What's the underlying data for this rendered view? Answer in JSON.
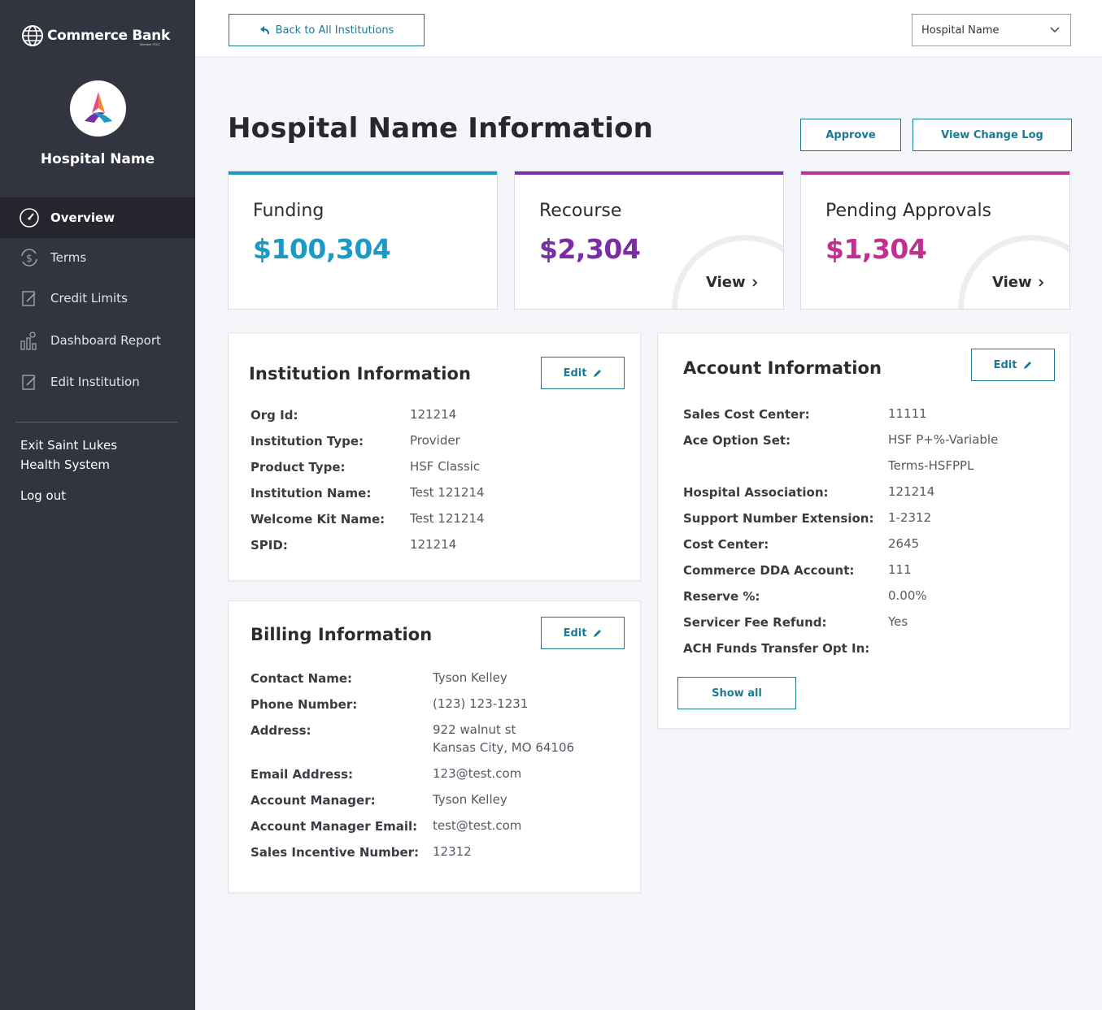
{
  "brand": {
    "name": "Commerce Bank",
    "sub": "Member FDIC"
  },
  "sidebar": {
    "hospital_name": "Hospital Name",
    "items": [
      {
        "label": "Overview",
        "icon": "speedometer-icon",
        "active": true
      },
      {
        "label": "Terms",
        "icon": "dollar-cycle-icon"
      },
      {
        "label": "Credit Limits",
        "icon": "document-edit-icon"
      },
      {
        "label": "Dashboard Report",
        "icon": "report-people-icon"
      },
      {
        "label": "Edit Institution",
        "icon": "document-edit-icon"
      }
    ],
    "exit_line1": "Exit Saint Lukes",
    "exit_line2": "Health System",
    "logout": "Log out"
  },
  "topbar": {
    "back_label": "Back to All Institutions",
    "select_value": "Hospital Name"
  },
  "header": {
    "title": "Hospital Name Information",
    "approve_label": "Approve",
    "change_log_label": "View Change Log"
  },
  "stats": [
    {
      "label": "Funding",
      "value": "$100,304",
      "color": "#1a9ac4"
    },
    {
      "label": "Recourse",
      "value": "$2,304",
      "color": "#7b2ea3",
      "link": "View"
    },
    {
      "label": "Pending Approvals",
      "value": "$1,304",
      "color": "#c22f93",
      "link": "View"
    }
  ],
  "institution": {
    "title": "Institution Information",
    "edit_label": "Edit",
    "rows": [
      {
        "label": "Org Id:",
        "value": "121214"
      },
      {
        "label": "Institution Type:",
        "value": "Provider"
      },
      {
        "label": "Product Type:",
        "value": "HSF Classic"
      },
      {
        "label": "Institution Name:",
        "value": "Test 121214"
      },
      {
        "label": "Welcome Kit Name:",
        "value": "Test 121214"
      },
      {
        "label": "SPID:",
        "value": "121214"
      }
    ]
  },
  "billing": {
    "title": "Billing Information",
    "edit_label": "Edit",
    "rows": [
      {
        "label": "Contact Name:",
        "value": "Tyson Kelley"
      },
      {
        "label": "Phone Number:",
        "value": "(123) 123-1231"
      },
      {
        "label": "Address:",
        "value": "922 walnut st",
        "value2": "Kansas City, MO 64106"
      },
      {
        "label": "Email Address:",
        "value": "123@test.com"
      },
      {
        "label": "Account Manager:",
        "value": "Tyson Kelley"
      },
      {
        "label": "Account Manager Email:",
        "value": "test@test.com"
      },
      {
        "label": "Sales Incentive Number:",
        "value": "12312"
      }
    ]
  },
  "account": {
    "title": "Account Information",
    "edit_label": "Edit",
    "show_all_label": "Show all",
    "rows": [
      {
        "label": "Sales Cost Center:",
        "value": "11111"
      },
      {
        "label": "Ace Option Set:",
        "value": "HSF P+%-Variable",
        "value2": "Terms-HSFPPL"
      },
      {
        "label": "Hospital Association:",
        "value": "121214"
      },
      {
        "label": "Support Number Extension:",
        "value": "1-2312"
      },
      {
        "label": "Cost Center:",
        "value": "2645"
      },
      {
        "label": "Commerce DDA Account:",
        "value": "111"
      },
      {
        "label": "Reserve %:",
        "value": "0.00%"
      },
      {
        "label": "Servicer Fee Refund:",
        "value": "Yes"
      },
      {
        "label": "ACH Funds Transfer Opt In:",
        "value": ""
      }
    ]
  }
}
